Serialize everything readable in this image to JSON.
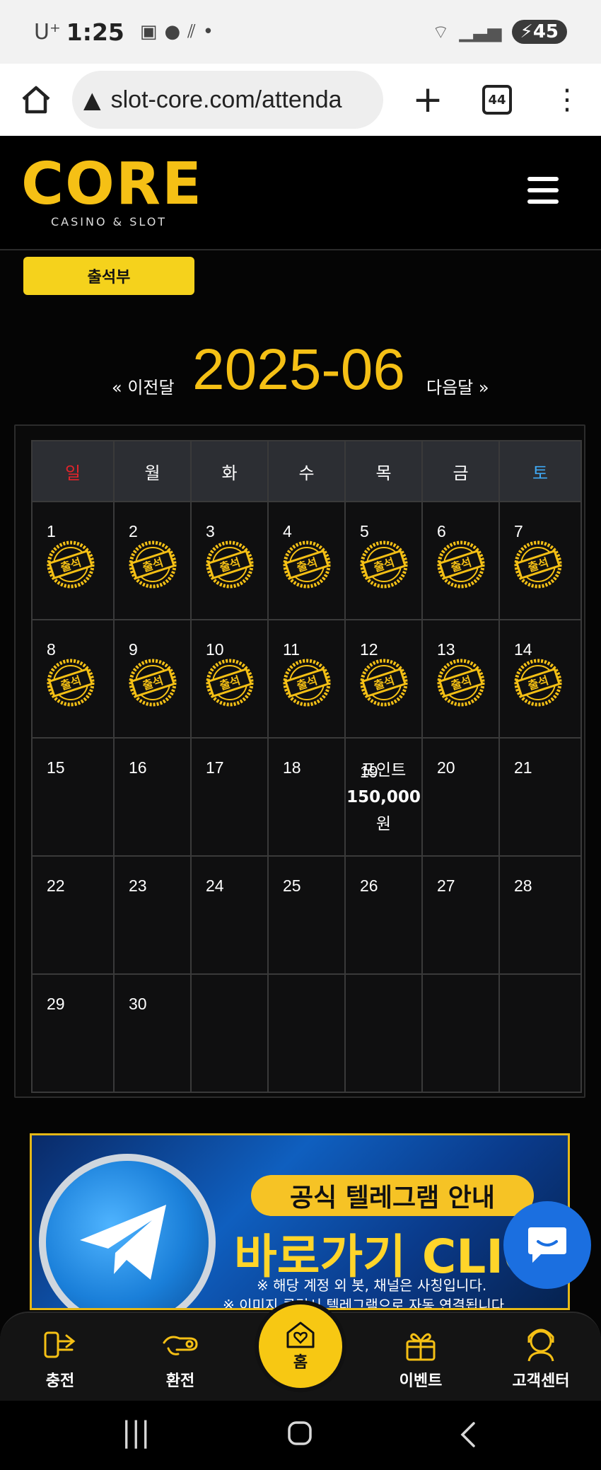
{
  "status_bar": {
    "carrier": "U⁺",
    "time": "1:25",
    "battery": "45"
  },
  "browser": {
    "url": "slot-core.com/attenda",
    "tab_count": "44"
  },
  "header": {
    "logo_text": "CORE",
    "logo_sub": "CASINO & SLOT"
  },
  "page": {
    "tab_label": "출석부"
  },
  "calendar": {
    "prev_label": "« 이전달",
    "next_label": "다음달 »",
    "month": "2025-06",
    "weekdays": [
      "일",
      "월",
      "화",
      "수",
      "목",
      "금",
      "토"
    ],
    "stamp_text": "출석",
    "days": [
      "1",
      "2",
      "3",
      "4",
      "5",
      "6",
      "7",
      "8",
      "9",
      "10",
      "11",
      "12",
      "13",
      "14",
      "15",
      "16",
      "17",
      "18",
      "19",
      "20",
      "21",
      "22",
      "23",
      "24",
      "25",
      "26",
      "27",
      "28",
      "29",
      "30"
    ],
    "attended_through": 14,
    "reward": {
      "day": "19",
      "label": "포인트",
      "amount": "150,000",
      "unit": "원"
    }
  },
  "banner": {
    "title": "공식 텔레그램 안내",
    "cta": "바로가기 CLICK",
    "note1": "※ 해당 계정 외 봇, 채널은 사칭입니다.",
    "note2": "※ 이미지 클릭시 텔레그램으로 자동 연결됩니다."
  },
  "bottom_nav": {
    "deposit": "충전",
    "withdraw": "환전",
    "home": "홈",
    "event": "이벤트",
    "support": "고객센터"
  },
  "colors": {
    "accent": "#f5c015",
    "sunday": "#e3242b",
    "saturday": "#3fa9f5",
    "chat_button": "#1b6fe0"
  }
}
